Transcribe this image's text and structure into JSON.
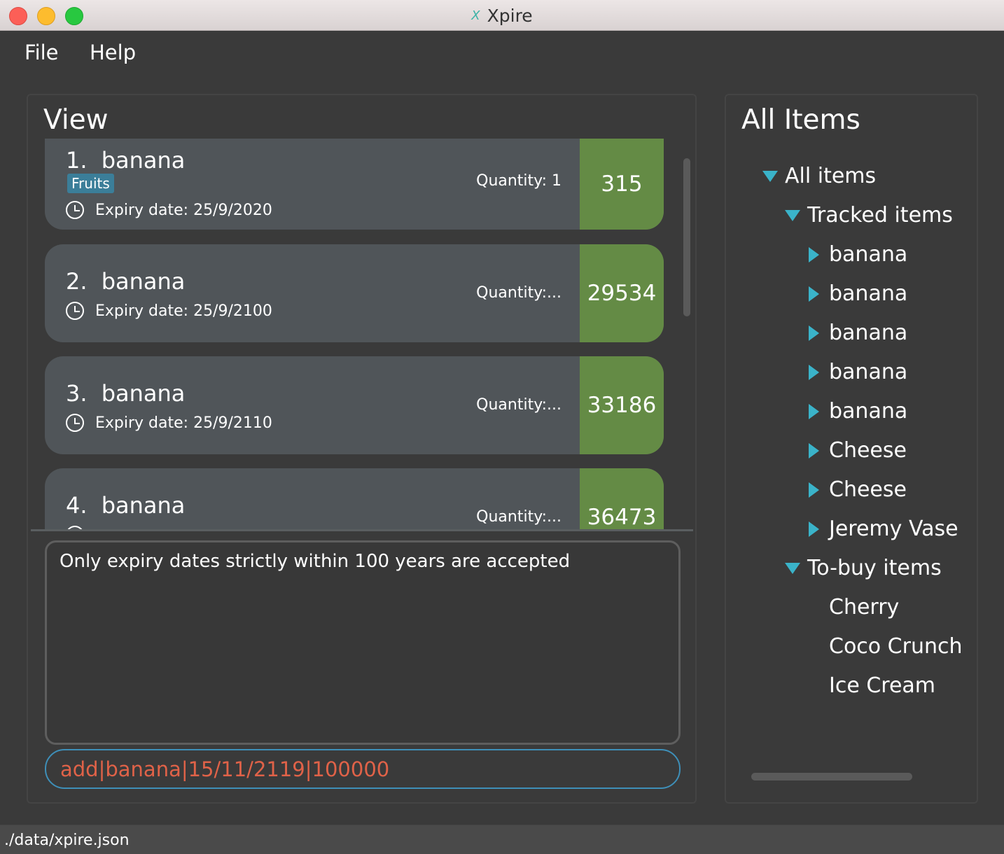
{
  "window": {
    "title": "Xpire",
    "icon": "xpire-app-icon",
    "icon_glyph": "X"
  },
  "menu": {
    "file": "File",
    "help": "Help"
  },
  "view": {
    "title": "View",
    "items": [
      {
        "index": "1.",
        "name": "banana",
        "tag": "Fruits",
        "expiry": "Expiry date: 25/9/2020",
        "quantity": "Quantity: 1",
        "days": "315"
      },
      {
        "index": "2.",
        "name": "banana",
        "tag": "",
        "expiry": "Expiry date: 25/9/2100",
        "quantity": "Quantity:...",
        "days": "29534"
      },
      {
        "index": "3.",
        "name": "banana",
        "tag": "",
        "expiry": "Expiry date: 25/9/2110",
        "quantity": "Quantity:...",
        "days": "33186"
      },
      {
        "index": "4.",
        "name": "banana",
        "tag": "",
        "expiry": "",
        "quantity": "Quantity:...",
        "days": "36473"
      }
    ],
    "result_message": "Only expiry dates strictly within 100 years are accepted",
    "command_input": "add|banana|15/11/2119|100000"
  },
  "tree": {
    "title": "All Items",
    "root": "All items",
    "tracked_label": "Tracked items",
    "tracked": [
      "banana",
      "banana",
      "banana",
      "banana",
      "banana",
      "Cheese",
      "Cheese",
      "Jeremy Vase"
    ],
    "tobuy_label": "To-buy items",
    "tobuy": [
      "Cherry",
      "Coco Crunch",
      "Ice Cream"
    ]
  },
  "status": {
    "path": "./data/xpire.json"
  },
  "colors": {
    "badge": "#648b45",
    "tag": "#3b7e99",
    "tree_arrow": "#3ab3c9",
    "command_text": "#e06248",
    "command_border": "#3e8fb8"
  }
}
